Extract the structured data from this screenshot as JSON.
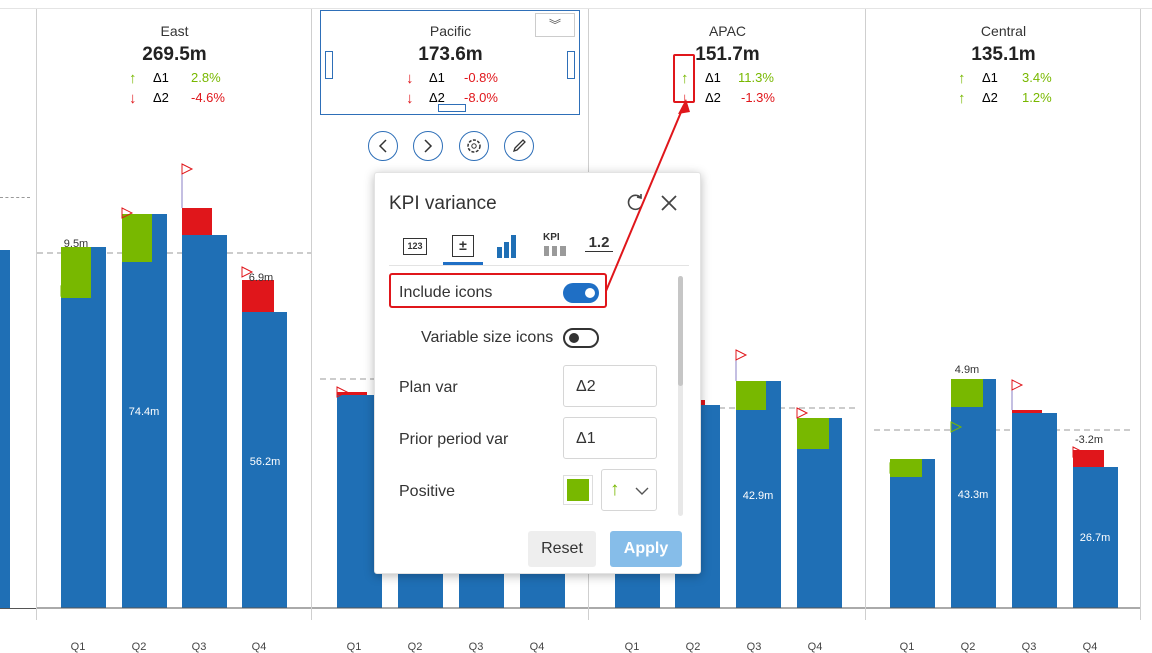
{
  "panels": [
    {
      "title": "East",
      "value": "269.5m",
      "var1": {
        "label": "Δ1",
        "value": "2.8%",
        "dir": "up"
      },
      "var2": {
        "label": "Δ2",
        "value": "-4.6%",
        "dir": "down"
      }
    },
    {
      "title": "Pacific",
      "value": "173.6m",
      "var1": {
        "label": "Δ1",
        "value": "-0.8%",
        "dir": "down"
      },
      "var2": {
        "label": "Δ2",
        "value": "-8.0%",
        "dir": "down"
      }
    },
    {
      "title": "APAC",
      "value": "151.7m",
      "var1": {
        "label": "Δ1",
        "value": "11.3%",
        "dir": "up"
      },
      "var2": {
        "label": "Δ2",
        "value": "-1.3%",
        "dir": "down"
      }
    },
    {
      "title": "Central",
      "value": "135.1m",
      "var1": {
        "label": "Δ1",
        "value": "3.4%",
        "dir": "up"
      },
      "var2": {
        "label": "Δ2",
        "value": "1.2%",
        "dir": "up"
      }
    }
  ],
  "quarters": [
    "Q1",
    "Q2",
    "Q3",
    "Q4"
  ],
  "bar_labels": {
    "east_q1_var": "9.5m",
    "east_q2_inner": "74.4m",
    "east_q4_var": "6.9m",
    "east_q4_inner": "56.2m",
    "apac_q3_inner": "42.9m",
    "central_q2_var": "4.9m",
    "central_q2_inner": "43.3m",
    "central_q4_var": "-3.2m",
    "central_q4_inner": "26.7m"
  },
  "dialog": {
    "title": "KPI variance",
    "tabs": [
      "123",
      "±",
      "bar",
      "KPI",
      "1.2"
    ],
    "include_icons": {
      "label": "Include icons",
      "on": true
    },
    "variable_size_icons": {
      "label": "Variable size icons",
      "on": false
    },
    "plan_var": {
      "label": "Plan var",
      "value": "Δ2"
    },
    "prior_period_var": {
      "label": "Prior period var",
      "value": "Δ1"
    },
    "positive": {
      "label": "Positive",
      "color": "#78b800",
      "icon": "arrow-up-icon"
    },
    "reset_label": "Reset",
    "apply_label": "Apply"
  },
  "colors": {
    "bar": "#1f6fb5",
    "positive": "#78b800",
    "negative": "#e0161b",
    "highlight": "#e0161b"
  }
}
